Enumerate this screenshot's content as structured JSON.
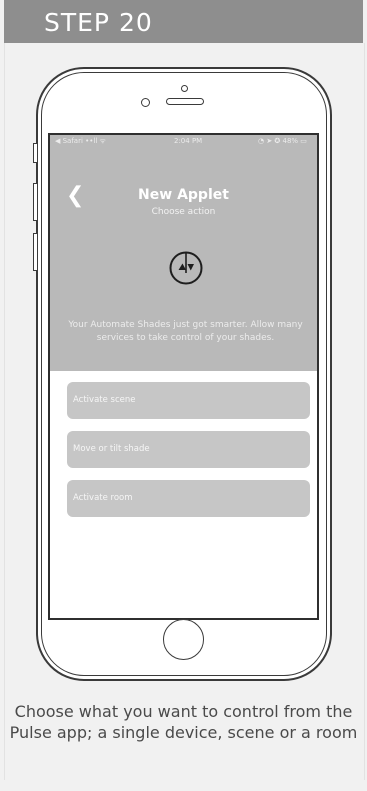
{
  "header": {
    "title": "STEP 20"
  },
  "status_bar": {
    "left": "◀ Safari ••ll ᯤ",
    "time": "2:04 PM",
    "right": "◔ ➤ ✪ 48% ▭"
  },
  "app": {
    "back_icon": "chevron-left-icon",
    "title": "New Applet",
    "subtitle": "Choose action",
    "logo_icon": "automate-shades-logo-icon",
    "description": "Your Automate Shades just got smarter. Allow many services to take control of your shades.",
    "options": [
      "Activate scene",
      "Move or tilt shade",
      "Activate room"
    ]
  },
  "caption": "Choose what you want to control from the Pulse app; a single device, scene or a room",
  "colors": {
    "header_bg": "#8e8e8e",
    "app_header_bg": "#b9b9b9",
    "option_bg": "#c6c6c6",
    "page_bg": "#f1f1f1"
  }
}
